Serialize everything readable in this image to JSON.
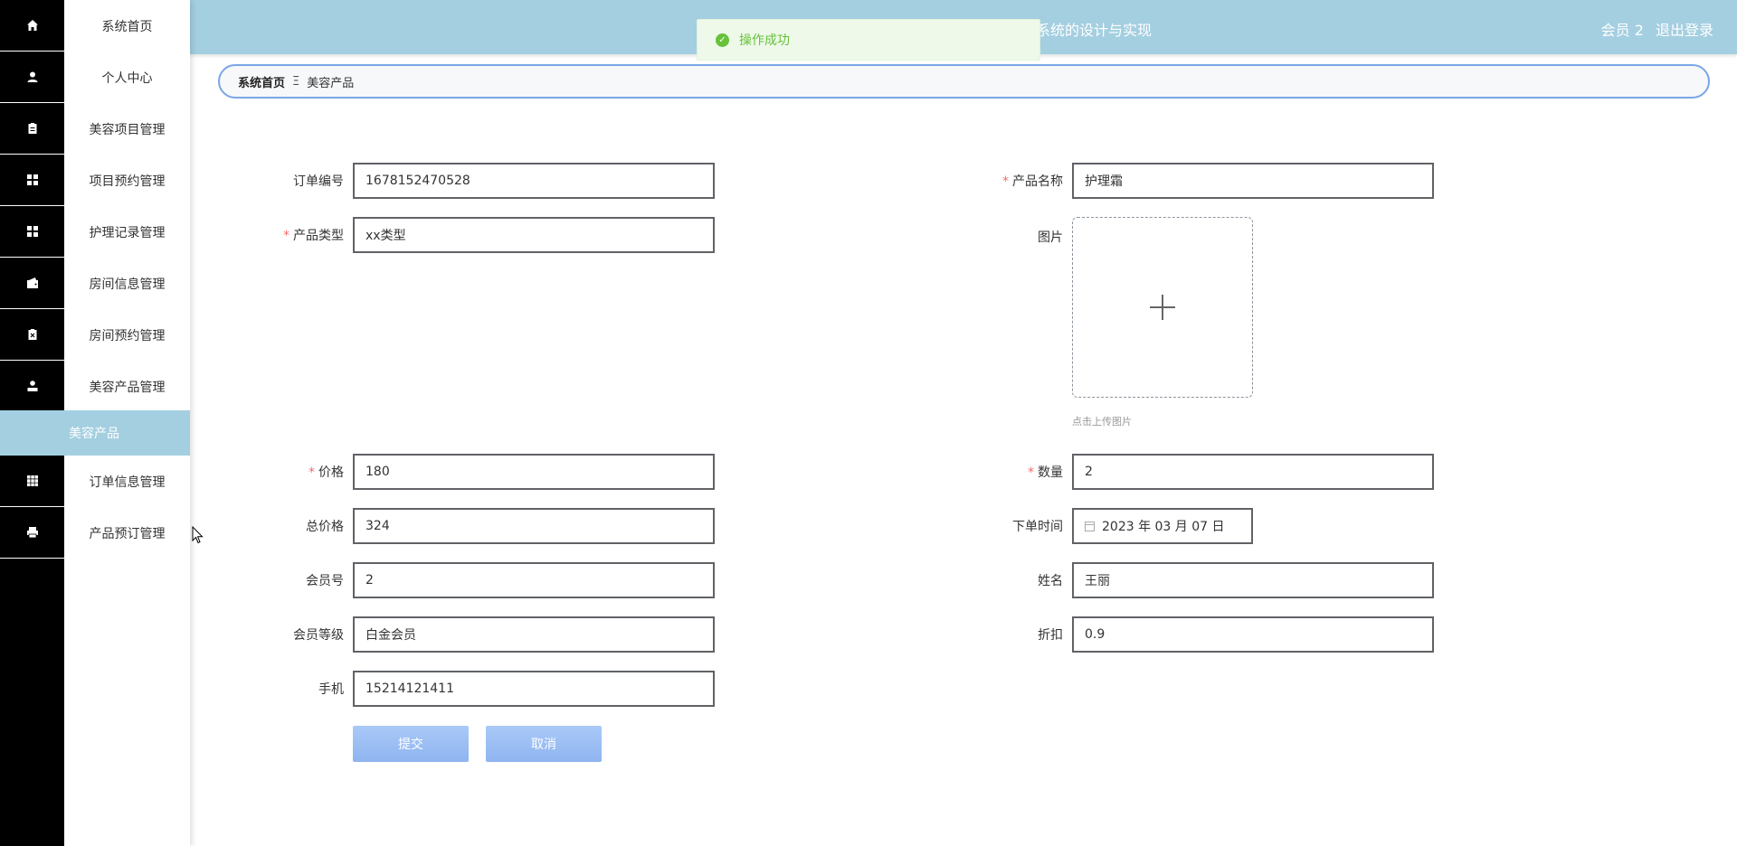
{
  "header": {
    "title": "系统的设计与实现",
    "user_label": "会员 2",
    "logout_label": "退出登录"
  },
  "toast": {
    "message": "操作成功"
  },
  "sidebar": {
    "items": [
      {
        "label": "系统首页",
        "icon": "home-icon"
      },
      {
        "label": "个人中心",
        "icon": "user-icon"
      },
      {
        "label": "美容项目管理",
        "icon": "clipboard-icon"
      },
      {
        "label": "项目预约管理",
        "icon": "grid-icon"
      },
      {
        "label": "护理记录管理",
        "icon": "grid-icon"
      },
      {
        "label": "房间信息管理",
        "icon": "wallet-icon"
      },
      {
        "label": "房间预约管理",
        "icon": "clipboard-x-icon"
      },
      {
        "label": "美容产品管理",
        "icon": "person-icon"
      },
      {
        "label": "订单信息管理",
        "icon": "table-icon"
      },
      {
        "label": "产品预订管理",
        "icon": "printer-icon"
      }
    ],
    "active_sub": "美容产品"
  },
  "breadcrumb": {
    "home": "系统首页",
    "separator": "Ξ",
    "current": "美容产品"
  },
  "form": {
    "order_no": {
      "label": "订单编号",
      "value": "1678152470528"
    },
    "product_name": {
      "label": "产品名称",
      "value": "护理霜"
    },
    "product_type": {
      "label": "产品类型",
      "value": "xx类型"
    },
    "image": {
      "label": "图片",
      "tip": "点击上传图片"
    },
    "price": {
      "label": "价格",
      "value": "180"
    },
    "quantity": {
      "label": "数量",
      "value": "2"
    },
    "total_price": {
      "label": "总价格",
      "value": "324"
    },
    "order_time": {
      "label": "下单时间",
      "value": "2023 年 03 月 07 日"
    },
    "member_no": {
      "label": "会员号",
      "value": "2"
    },
    "name": {
      "label": "姓名",
      "value": "王丽"
    },
    "member_level": {
      "label": "会员等级",
      "value": "白金会员"
    },
    "discount": {
      "label": "折扣",
      "value": "0.9"
    },
    "phone": {
      "label": "手机",
      "value": "15214121411"
    },
    "required_mark": "*",
    "submit_label": "提交",
    "cancel_label": "取消"
  },
  "colors": {
    "header_bg": "#a4cfe1",
    "success": "#67c23a",
    "required": "#f56c6c",
    "button": "#8fb4f0"
  }
}
